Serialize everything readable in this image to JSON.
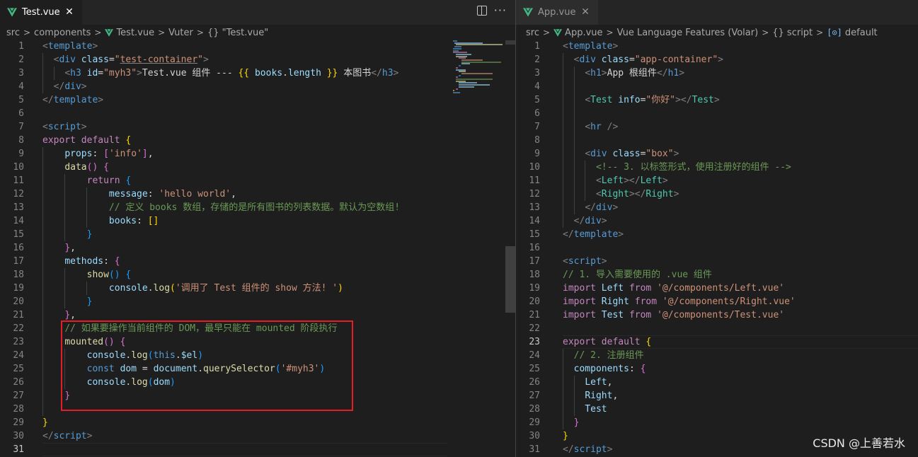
{
  "left": {
    "tab": {
      "label": "Test.vue",
      "close": "✕"
    },
    "breadcrumb": [
      "src",
      "components",
      "Test.vue",
      "Vuter",
      "{} \"Test.vue\""
    ],
    "current_line": 31,
    "lines": [
      [
        [
          "t-br",
          "<"
        ],
        [
          "t-tag",
          "template"
        ],
        [
          "t-br",
          ">"
        ]
      ],
      [
        [
          "t-p",
          "  "
        ],
        [
          "t-br",
          "<"
        ],
        [
          "t-tag",
          "div"
        ],
        [
          "t-p",
          " "
        ],
        [
          "t-attr",
          "class"
        ],
        [
          "t-p",
          "="
        ],
        [
          "t-str",
          "\""
        ],
        [
          "t-str t-squig",
          "test-container"
        ],
        [
          "t-str",
          "\""
        ],
        [
          "t-br",
          ">"
        ]
      ],
      [
        [
          "t-p",
          "    "
        ],
        [
          "t-br",
          "<"
        ],
        [
          "t-tag",
          "h3"
        ],
        [
          "t-p",
          " "
        ],
        [
          "t-attr",
          "id"
        ],
        [
          "t-p",
          "="
        ],
        [
          "t-str",
          "\"myh3\""
        ],
        [
          "t-br",
          ">"
        ],
        [
          "t-p",
          "Test.vue 组件 --- "
        ],
        [
          "t-b1",
          "{{"
        ],
        [
          "t-p",
          " "
        ],
        [
          "t-var",
          "books"
        ],
        [
          "t-p",
          "."
        ],
        [
          "t-var",
          "length"
        ],
        [
          "t-p",
          " "
        ],
        [
          "t-b1",
          "}}"
        ],
        [
          "t-p",
          " 本图书"
        ],
        [
          "t-br",
          "</"
        ],
        [
          "t-tag",
          "h3"
        ],
        [
          "t-br",
          ">"
        ]
      ],
      [
        [
          "t-p",
          "  "
        ],
        [
          "t-br",
          "</"
        ],
        [
          "t-tag",
          "div"
        ],
        [
          "t-br",
          ">"
        ]
      ],
      [
        [
          "t-br",
          "</"
        ],
        [
          "t-tag",
          "template"
        ],
        [
          "t-br",
          ">"
        ]
      ],
      [],
      [
        [
          "t-br",
          "<"
        ],
        [
          "t-tag",
          "script"
        ],
        [
          "t-br",
          ">"
        ]
      ],
      [
        [
          "t-ctrl",
          "export"
        ],
        [
          "t-p",
          " "
        ],
        [
          "t-ctrl",
          "default"
        ],
        [
          "t-p",
          " "
        ],
        [
          "t-b1",
          "{"
        ]
      ],
      [
        [
          "t-p",
          "    "
        ],
        [
          "t-var",
          "props"
        ],
        [
          "t-p",
          ": "
        ],
        [
          "t-b2",
          "["
        ],
        [
          "t-str",
          "'info'"
        ],
        [
          "t-b2",
          "]"
        ],
        [
          "t-p",
          ","
        ]
      ],
      [
        [
          "t-p",
          "    "
        ],
        [
          "t-fn",
          "data"
        ],
        [
          "t-b2",
          "()"
        ],
        [
          "t-p",
          " "
        ],
        [
          "t-b2",
          "{"
        ]
      ],
      [
        [
          "t-p",
          "        "
        ],
        [
          "t-ctrl",
          "return"
        ],
        [
          "t-p",
          " "
        ],
        [
          "t-b3",
          "{"
        ]
      ],
      [
        [
          "t-p",
          "            "
        ],
        [
          "t-var",
          "message"
        ],
        [
          "t-p",
          ": "
        ],
        [
          "t-str",
          "'hello world'"
        ],
        [
          "t-p",
          ","
        ]
      ],
      [
        [
          "t-p",
          "            "
        ],
        [
          "t-com",
          "// 定义 books 数组，存储的是所有图书的列表数据。默认为空数组!"
        ]
      ],
      [
        [
          "t-p",
          "            "
        ],
        [
          "t-var",
          "books"
        ],
        [
          "t-p",
          ": "
        ],
        [
          "t-b1",
          "[]"
        ]
      ],
      [
        [
          "t-p",
          "        "
        ],
        [
          "t-b3",
          "}"
        ]
      ],
      [
        [
          "t-p",
          "    "
        ],
        [
          "t-b2",
          "}"
        ],
        [
          "t-p",
          ","
        ]
      ],
      [
        [
          "t-p",
          "    "
        ],
        [
          "t-var",
          "methods"
        ],
        [
          "t-p",
          ": "
        ],
        [
          "t-b2",
          "{"
        ]
      ],
      [
        [
          "t-p",
          "        "
        ],
        [
          "t-fn",
          "show"
        ],
        [
          "t-b3",
          "()"
        ],
        [
          "t-p",
          " "
        ],
        [
          "t-b3",
          "{"
        ]
      ],
      [
        [
          "t-p",
          "            "
        ],
        [
          "t-var",
          "console"
        ],
        [
          "t-p",
          "."
        ],
        [
          "t-fn",
          "log"
        ],
        [
          "t-b1",
          "("
        ],
        [
          "t-str",
          "'调用了 Test 组件的 show 方法! '"
        ],
        [
          "t-b1",
          ")"
        ]
      ],
      [
        [
          "t-p",
          "        "
        ],
        [
          "t-b3",
          "}"
        ]
      ],
      [
        [
          "t-p",
          "    "
        ],
        [
          "t-b2",
          "}"
        ],
        [
          "t-p",
          ","
        ]
      ],
      [
        [
          "t-p",
          "    "
        ],
        [
          "t-com",
          "// 如果要操作当前组件的 DOM，最早只能在 mounted 阶段执行"
        ]
      ],
      [
        [
          "t-p",
          "    "
        ],
        [
          "t-fn",
          "mounted"
        ],
        [
          "t-b2",
          "()"
        ],
        [
          "t-p",
          " "
        ],
        [
          "t-b2",
          "{"
        ]
      ],
      [
        [
          "t-p",
          "        "
        ],
        [
          "t-var",
          "console"
        ],
        [
          "t-p",
          "."
        ],
        [
          "t-fn",
          "log"
        ],
        [
          "t-b3",
          "("
        ],
        [
          "t-kw",
          "this"
        ],
        [
          "t-p",
          "."
        ],
        [
          "t-var",
          "$el"
        ],
        [
          "t-b3",
          ")"
        ]
      ],
      [
        [
          "t-p",
          "        "
        ],
        [
          "t-kw",
          "const"
        ],
        [
          "t-p",
          " "
        ],
        [
          "t-var",
          "dom"
        ],
        [
          "t-p",
          " = "
        ],
        [
          "t-var",
          "document"
        ],
        [
          "t-p",
          "."
        ],
        [
          "t-fn",
          "querySelector"
        ],
        [
          "t-b3",
          "("
        ],
        [
          "t-str",
          "'#myh3'"
        ],
        [
          "t-b3",
          ")"
        ]
      ],
      [
        [
          "t-p",
          "        "
        ],
        [
          "t-var",
          "console"
        ],
        [
          "t-p",
          "."
        ],
        [
          "t-fn",
          "log"
        ],
        [
          "t-b3",
          "("
        ],
        [
          "t-var",
          "dom"
        ],
        [
          "t-b3",
          ")"
        ]
      ],
      [
        [
          "t-p",
          "    "
        ],
        [
          "t-b2",
          "}"
        ]
      ],
      [],
      [
        [
          "t-b1",
          "}"
        ]
      ],
      [
        [
          "t-br",
          "</"
        ],
        [
          "t-tag",
          "script"
        ],
        [
          "t-br",
          ">"
        ]
      ],
      []
    ]
  },
  "right": {
    "tab": {
      "label": "App.vue",
      "close": "✕"
    },
    "breadcrumb": [
      "src",
      "App.vue",
      "Vue Language Features (Volar)",
      "{} script",
      "default"
    ],
    "current_line": 23,
    "lines": [
      [
        [
          "t-br",
          "<"
        ],
        [
          "t-tag",
          "template"
        ],
        [
          "t-br",
          ">"
        ]
      ],
      [
        [
          "t-p",
          "  "
        ],
        [
          "t-br",
          "<"
        ],
        [
          "t-tag",
          "div"
        ],
        [
          "t-p",
          " "
        ],
        [
          "t-attr",
          "class"
        ],
        [
          "t-p",
          "="
        ],
        [
          "t-str",
          "\"app-container\""
        ],
        [
          "t-br",
          ">"
        ]
      ],
      [
        [
          "t-p",
          "    "
        ],
        [
          "t-br",
          "<"
        ],
        [
          "t-tag",
          "h1"
        ],
        [
          "t-br",
          ">"
        ],
        [
          "t-p",
          "App 根组件"
        ],
        [
          "t-br",
          "</"
        ],
        [
          "t-tag",
          "h1"
        ],
        [
          "t-br",
          ">"
        ]
      ],
      [],
      [
        [
          "t-p",
          "    "
        ],
        [
          "t-br",
          "<"
        ],
        [
          "t-comp",
          "Test"
        ],
        [
          "t-p",
          " "
        ],
        [
          "t-attr",
          "info"
        ],
        [
          "t-p",
          "="
        ],
        [
          "t-str",
          "\"你好\""
        ],
        [
          "t-br",
          "></"
        ],
        [
          "t-comp",
          "Test"
        ],
        [
          "t-br",
          ">"
        ]
      ],
      [],
      [
        [
          "t-p",
          "    "
        ],
        [
          "t-br",
          "<"
        ],
        [
          "t-tag",
          "hr"
        ],
        [
          "t-p",
          " "
        ],
        [
          "t-br",
          "/>"
        ]
      ],
      [],
      [
        [
          "t-p",
          "    "
        ],
        [
          "t-br",
          "<"
        ],
        [
          "t-tag",
          "div"
        ],
        [
          "t-p",
          " "
        ],
        [
          "t-attr",
          "class"
        ],
        [
          "t-p",
          "="
        ],
        [
          "t-str",
          "\"box\""
        ],
        [
          "t-br",
          ">"
        ]
      ],
      [
        [
          "t-p",
          "      "
        ],
        [
          "t-com",
          "<!-- 3. 以标签形式，使用注册好的组件 -->"
        ]
      ],
      [
        [
          "t-p",
          "      "
        ],
        [
          "t-br",
          "<"
        ],
        [
          "t-comp",
          "Left"
        ],
        [
          "t-br",
          "></"
        ],
        [
          "t-comp",
          "Left"
        ],
        [
          "t-br",
          ">"
        ]
      ],
      [
        [
          "t-p",
          "      "
        ],
        [
          "t-br",
          "<"
        ],
        [
          "t-comp",
          "Right"
        ],
        [
          "t-br",
          "></"
        ],
        [
          "t-comp",
          "Right"
        ],
        [
          "t-br",
          ">"
        ]
      ],
      [
        [
          "t-p",
          "    "
        ],
        [
          "t-br",
          "</"
        ],
        [
          "t-tag",
          "div"
        ],
        [
          "t-br",
          ">"
        ]
      ],
      [
        [
          "t-p",
          "  "
        ],
        [
          "t-br",
          "</"
        ],
        [
          "t-tag",
          "div"
        ],
        [
          "t-br",
          ">"
        ]
      ],
      [
        [
          "t-br",
          "</"
        ],
        [
          "t-tag",
          "template"
        ],
        [
          "t-br",
          ">"
        ]
      ],
      [],
      [
        [
          "t-br",
          "<"
        ],
        [
          "t-tag",
          "script"
        ],
        [
          "t-br",
          ">"
        ]
      ],
      [
        [
          "t-com",
          "// 1. 导入需要使用的 .vue 组件"
        ]
      ],
      [
        [
          "t-ctrl",
          "import"
        ],
        [
          "t-p",
          " "
        ],
        [
          "t-var",
          "Left"
        ],
        [
          "t-p",
          " "
        ],
        [
          "t-ctrl",
          "from"
        ],
        [
          "t-p",
          " "
        ],
        [
          "t-str",
          "'@/components/Left.vue'"
        ]
      ],
      [
        [
          "t-ctrl",
          "import"
        ],
        [
          "t-p",
          " "
        ],
        [
          "t-var",
          "Right"
        ],
        [
          "t-p",
          " "
        ],
        [
          "t-ctrl",
          "from"
        ],
        [
          "t-p",
          " "
        ],
        [
          "t-str",
          "'@/components/Right.vue'"
        ]
      ],
      [
        [
          "t-ctrl",
          "import"
        ],
        [
          "t-p",
          " "
        ],
        [
          "t-var",
          "Test"
        ],
        [
          "t-p",
          " "
        ],
        [
          "t-ctrl",
          "from"
        ],
        [
          "t-p",
          " "
        ],
        [
          "t-str",
          "'@/components/Test.vue'"
        ]
      ],
      [],
      [
        [
          "t-ctrl",
          "export"
        ],
        [
          "t-p",
          " "
        ],
        [
          "t-ctrl",
          "default"
        ],
        [
          "t-p",
          " "
        ],
        [
          "t-b1",
          "{"
        ]
      ],
      [
        [
          "t-p",
          "  "
        ],
        [
          "t-com",
          "// 2. 注册组件"
        ]
      ],
      [
        [
          "t-p",
          "  "
        ],
        [
          "t-var",
          "components"
        ],
        [
          "t-p",
          ": "
        ],
        [
          "t-b2",
          "{"
        ]
      ],
      [
        [
          "t-p",
          "    "
        ],
        [
          "t-var",
          "Left"
        ],
        [
          "t-p",
          ","
        ]
      ],
      [
        [
          "t-p",
          "    "
        ],
        [
          "t-var",
          "Right"
        ],
        [
          "t-p",
          ","
        ]
      ],
      [
        [
          "t-p",
          "    "
        ],
        [
          "t-var",
          "Test"
        ]
      ],
      [
        [
          "t-p",
          "  "
        ],
        [
          "t-b2",
          "}"
        ]
      ],
      [
        [
          "t-b1",
          "}"
        ]
      ],
      [
        [
          "t-br",
          "</"
        ],
        [
          "t-tag",
          "script"
        ],
        [
          "t-br",
          ">"
        ]
      ]
    ]
  },
  "watermark": "CSDN @上善若水",
  "colors": {
    "editor_bg": "#1e1e1e",
    "tabbar_bg": "#252526",
    "highlight_box": "#e51e25",
    "vue_logo_green": "#41b883",
    "vue_logo_dark": "#35495e"
  }
}
